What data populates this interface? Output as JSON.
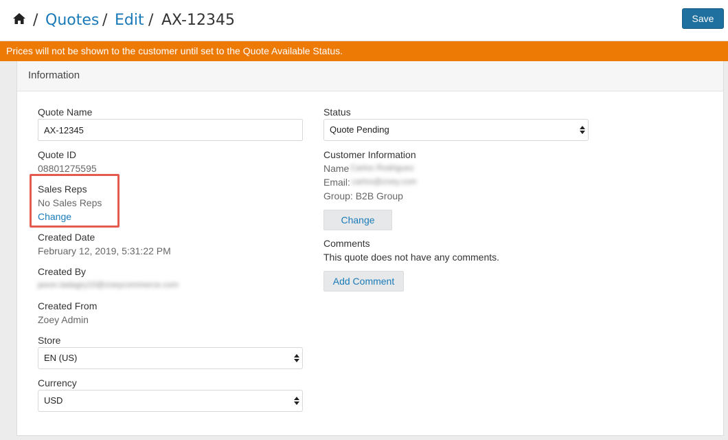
{
  "breadcrumb": {
    "home_icon": "home-icon",
    "separator": "/",
    "items": [
      {
        "label": "Quotes"
      },
      {
        "label": "Edit"
      },
      {
        "label": "AX-12345"
      }
    ]
  },
  "toolbar": {
    "save_label": "Save"
  },
  "banner": {
    "text": "Prices will not be shown to the customer until set to the Quote Available Status.",
    "color": "#ee7a06"
  },
  "panel": {
    "title": "Information"
  },
  "form": {
    "quote_name": {
      "label": "Quote Name",
      "value": "AX-12345"
    },
    "quote_id": {
      "label": "Quote ID",
      "value": "08801275595"
    },
    "sales_reps": {
      "label": "Sales Reps",
      "value": "No Sales Reps",
      "change_label": "Change"
    },
    "created_date": {
      "label": "Created Date",
      "value": "February 12, 2019, 5:31:22 PM"
    },
    "created_by": {
      "label": "Created By",
      "value": "jason.tadagry10@zoeycommerce.com"
    },
    "created_from": {
      "label": "Created From",
      "value": "Zoey Admin"
    },
    "store": {
      "label": "Store",
      "selected": "EN (US)"
    },
    "currency": {
      "label": "Currency",
      "selected": "USD"
    },
    "status": {
      "label": "Status",
      "selected": "Quote Pending"
    },
    "customer_info": {
      "label": "Customer Information",
      "name_label": "Name",
      "name_value": "Carlos Rodriguez",
      "email_label": "Email:",
      "email_value": "carlos@zoey.com",
      "group_text": "Group: B2B Group",
      "change_label": "Change"
    },
    "comments": {
      "label": "Comments",
      "empty_text": "This quote does not have any comments.",
      "add_label": "Add Comment"
    }
  },
  "colors": {
    "accent": "#1a7ab8",
    "save": "#1f6f9f",
    "highlight": "#e25b4e"
  }
}
